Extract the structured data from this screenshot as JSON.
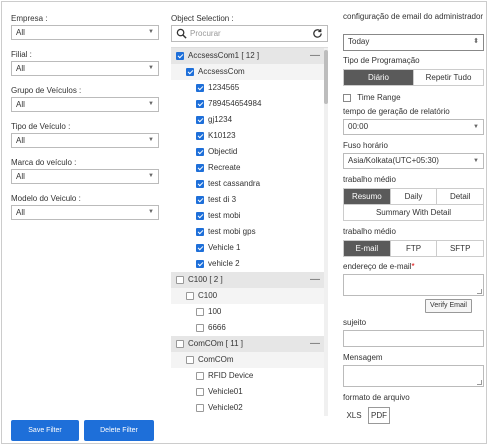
{
  "filters": {
    "empresa": {
      "label": "Empresa :",
      "value": "All"
    },
    "filial": {
      "label": "Filial :",
      "value": "All"
    },
    "grupo": {
      "label": "Grupo de Veículos :",
      "value": "All"
    },
    "tipo": {
      "label": "Tipo de Veículo :",
      "value": "All"
    },
    "marca": {
      "label": "Marca do veículo :",
      "value": "All"
    },
    "modelo": {
      "label": "Modelo do Veiculo :",
      "value": "All"
    }
  },
  "buttons": {
    "save": "Save Filter",
    "delete": "Delete Filter"
  },
  "objects": {
    "label": "Object Selection :",
    "search_placeholder": "Procurar",
    "rows": [
      {
        "text": "AccsessCom1 [ 12 ]",
        "level": 0,
        "checked": true,
        "kind": "group",
        "minus": "—"
      },
      {
        "text": "AccsessCom",
        "level": 1,
        "checked": true,
        "kind": "sub"
      },
      {
        "text": "1234565",
        "level": 2,
        "checked": true
      },
      {
        "text": "789454654984",
        "level": 2,
        "checked": true
      },
      {
        "text": "gj1234",
        "level": 2,
        "checked": true
      },
      {
        "text": "K10123",
        "level": 2,
        "checked": true
      },
      {
        "text": "Objectid",
        "level": 2,
        "checked": true
      },
      {
        "text": "Recreate",
        "level": 2,
        "checked": true
      },
      {
        "text": "test cassandra",
        "level": 2,
        "checked": true
      },
      {
        "text": "test di 3",
        "level": 2,
        "checked": true
      },
      {
        "text": "test mobi",
        "level": 2,
        "checked": true
      },
      {
        "text": "test mobi gps",
        "level": 2,
        "checked": true
      },
      {
        "text": "Vehicle 1",
        "level": 2,
        "checked": true
      },
      {
        "text": "vehicle 2",
        "level": 2,
        "checked": true
      },
      {
        "text": "C100 [ 2 ]",
        "level": 0,
        "checked": false,
        "kind": "group",
        "minus": "—"
      },
      {
        "text": "C100",
        "level": 1,
        "checked": false,
        "kind": "sub"
      },
      {
        "text": "100",
        "level": 2,
        "checked": false
      },
      {
        "text": "6666",
        "level": 2,
        "checked": false
      },
      {
        "text": "ComCOm [ 11 ]",
        "level": 0,
        "checked": false,
        "kind": "group",
        "minus": "—"
      },
      {
        "text": "ComCOm",
        "level": 1,
        "checked": false,
        "kind": "sub"
      },
      {
        "text": "RFID Device",
        "level": 2,
        "checked": false
      },
      {
        "text": "Vehicle01",
        "level": 2,
        "checked": false
      },
      {
        "text": "Vehicle02",
        "level": 2,
        "checked": false
      }
    ]
  },
  "right": {
    "email_config_label": "configuração de email do administrador",
    "email_config_value": "Today",
    "schedule_label": "Tipo de Programação",
    "schedule_options": [
      "Diário",
      "Repetir Tudo"
    ],
    "time_range_label": "Time Range",
    "gen_time_label": "tempo de geração de relatório",
    "gen_time_value": "00:00",
    "timezone_label": "Fuso horário",
    "timezone_value": "Asia/Kolkata(UTC+05:30)",
    "work1_label": "trabalho médio",
    "work1_options": [
      "Resumo",
      "Daily",
      "Detail"
    ],
    "work1_extra": "Summary With Detail",
    "work2_label": "trabalho médio",
    "work2_options": [
      "E-mail",
      "FTP",
      "SFTP"
    ],
    "email_label": "endereço de e-mail",
    "required_mark": "*",
    "verify_label": "Verify Email",
    "subject_label": "sujeito",
    "message_label": "Mensagem",
    "format_label": "formato de arquivo",
    "format_options": [
      "XLS",
      "PDF"
    ]
  },
  "colors": {
    "accent": "#1e6fd9",
    "segment_active": "#5a5a5a"
  }
}
